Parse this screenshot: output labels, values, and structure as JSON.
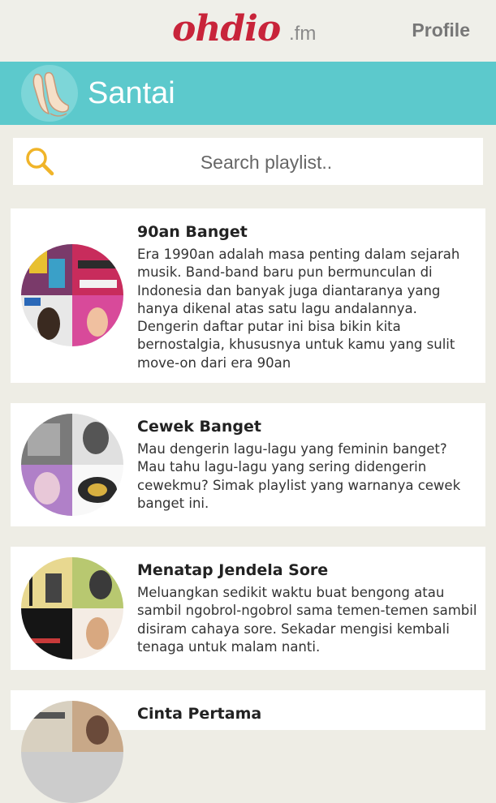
{
  "app": {
    "logo_main": "ohdio",
    "logo_suffix": ".fm",
    "profile_label": "Profile",
    "brand_color": "#c8243a"
  },
  "header": {
    "title": "Santai",
    "icon": "hands-icon",
    "color": "#5cc9cc"
  },
  "search": {
    "placeholder": "Search playlist..",
    "icon": "search-icon"
  },
  "playlists": [
    {
      "title": "90an Banget",
      "description": "Era 1990an adalah masa penting dalam sejarah musik. Band-band baru pun bermunculan di Indonesia dan banyak juga diantaranya yang hanya dikenal atas satu lagu andalannya. Dengerin daftar putar ini bisa bikin kita bernostalgia, khususnya untuk kamu yang sulit move-on dari era 90an"
    },
    {
      "title": "Cewek Banget",
      "description": "Mau dengerin lagu-lagu yang feminin banget? Mau tahu lagu-lagu yang sering didengerin cewekmu? Simak playlist yang warnanya cewek banget ini."
    },
    {
      "title": "Menatap Jendela Sore",
      "description": "Meluangkan sedikit waktu buat bengong atau sambil ngobrol-ngobrol sama temen-temen sambil disiram cahaya sore. Sekadar mengisi kembali tenaga untuk malam nanti."
    },
    {
      "title": "Cinta Pertama",
      "description": ""
    }
  ]
}
